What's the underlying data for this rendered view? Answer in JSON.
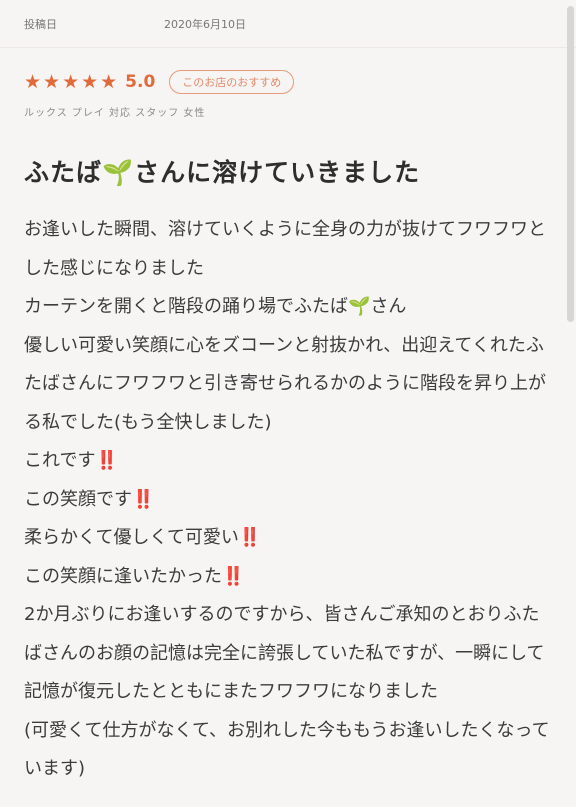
{
  "header": {
    "label": "投稿日",
    "date": "2020年6月10日"
  },
  "review": {
    "stars": "★★★★★",
    "score": "5.0",
    "badge": "このお店のおすすめ",
    "meta": "ルックス プレイ 対応 スタッフ 女性",
    "title": "ふたば",
    "title_sprout": "🌱",
    "title_tail": "さんに溶けていきました",
    "paragraphs": [
      {
        "text": "お逢いした瞬間、溶けていくように全身の力が抜けてフワフワとした感じになりました",
        "mark": ""
      },
      {
        "text": "カーテンを開くと階段の踊り場でふたば",
        "mark": "🌱",
        "tail": "さん"
      },
      {
        "text": "優しい可愛い笑顔に心をズコーンと射抜かれ、出迎えてくれたふたばさんにフワフワと引き寄せられるかのように階段を昇り上がる私でした(もう全快しました)",
        "mark": ""
      },
      {
        "text": "これです",
        "mark": "‼️"
      },
      {
        "text": "この笑顔です",
        "mark": "‼️"
      },
      {
        "text": "柔らかくて優しくて可愛い",
        "mark": "‼️"
      },
      {
        "text": "この笑顔に逢いたかった",
        "mark": "‼️"
      },
      {
        "text": "2か月ぶりにお逢いするのですから、皆さんご承知のとおりふたばさんのお顔の記憶は完全に誇張していた私ですが、一瞬にして記憶が復元したとともにまたフワフワになりました",
        "mark": ""
      },
      {
        "text": "(可愛くて仕方がなくて、お別れした今ももうお逢いしたくなっています)",
        "mark": ""
      }
    ]
  }
}
